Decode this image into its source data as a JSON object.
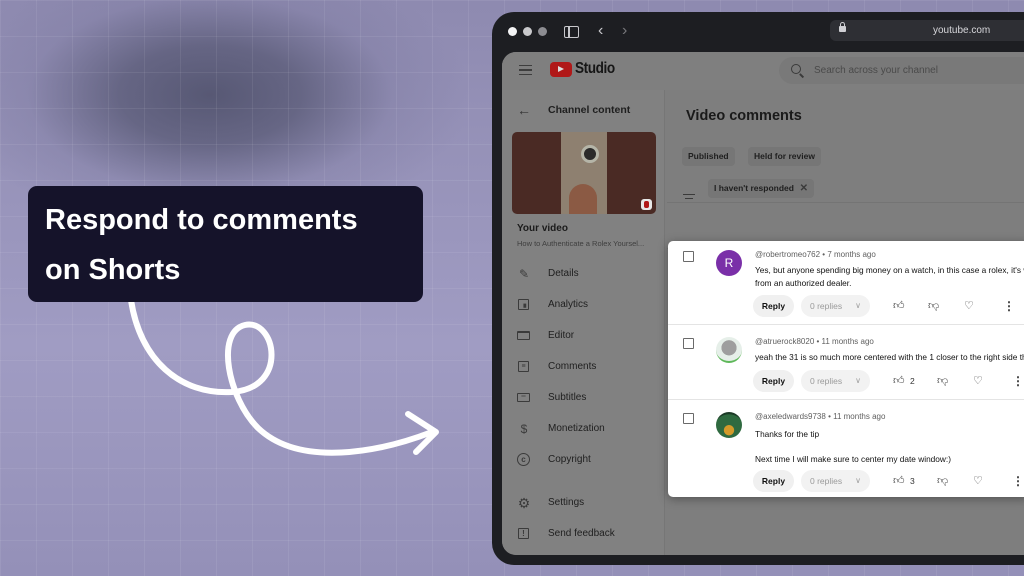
{
  "overlay": {
    "callout_line1": "Respond to comments",
    "callout_line2": "on Shorts"
  },
  "browser": {
    "url": "youtube.com",
    "back_icon": "chevron-left-icon",
    "forward_icon": "chevron-right-icon"
  },
  "header": {
    "brand": "Studio",
    "search_placeholder": "Search across your channel"
  },
  "left_nav": {
    "back_label": "Channel content",
    "video_heading": "Your video",
    "video_title": "How to Authenticate a Rolex Yoursel...",
    "items": [
      {
        "label": "Details",
        "icon": "pencil-icon"
      },
      {
        "label": "Analytics",
        "icon": "analytics-icon"
      },
      {
        "label": "Editor",
        "icon": "editor-icon"
      },
      {
        "label": "Comments",
        "icon": "comments-icon"
      },
      {
        "label": "Subtitles",
        "icon": "subtitles-icon"
      },
      {
        "label": "Monetization",
        "icon": "dollar-icon"
      },
      {
        "label": "Copyright",
        "icon": "copyright-icon"
      }
    ],
    "bottom_items": [
      {
        "label": "Settings",
        "icon": "gear-icon"
      },
      {
        "label": "Send feedback",
        "icon": "feedback-icon"
      }
    ]
  },
  "main": {
    "title": "Video comments",
    "tabs": [
      {
        "label": "Published"
      },
      {
        "label": "Held for review"
      }
    ],
    "filter_chip": "I haven't responded"
  },
  "comments": [
    {
      "author": "@robertromeo762",
      "time": "7 months ago",
      "avatar_letter": "R",
      "text_lines": [
        "Yes, but anyone spending big money on a watch, in this case a rolex, it's w",
        "from an authorized dealer."
      ],
      "likes": "",
      "reply_label": "Reply",
      "replies_label": "0 replies"
    },
    {
      "author": "@atruerock8020",
      "time": "11 months ago",
      "avatar_letter": "",
      "text_lines": [
        "yeah the 31 is so much more centered with the 1 closer to the right side th"
      ],
      "likes": "2",
      "reply_label": "Reply",
      "replies_label": "0 replies"
    },
    {
      "author": "@axeledwards9738",
      "time": "11 months ago",
      "avatar_letter": "",
      "text_lines": [
        "Thanks for the tip",
        "",
        "Next time I will make sure to center my date window:)"
      ],
      "likes": "3",
      "reply_label": "Reply",
      "replies_label": "0 replies"
    }
  ],
  "colors": {
    "brand_red": "#b01818",
    "callout_bg": "#15132a",
    "avatar_purple": "#7a2fa8"
  }
}
